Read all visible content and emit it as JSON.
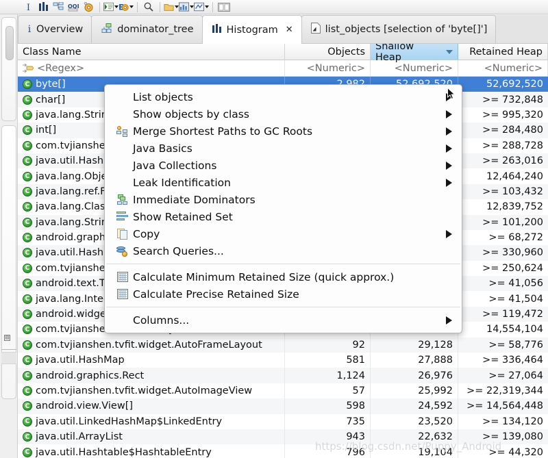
{
  "toolbar": {
    "buttons": [
      {
        "name": "info-icon",
        "glyph": "I",
        "caret": false
      },
      {
        "name": "histogram-icon",
        "glyph": "bars",
        "caret": false
      },
      {
        "name": "dominator-tree-icon",
        "glyph": "tree",
        "caret": false
      },
      {
        "name": "oql-icon",
        "glyph": "OQL",
        "caret": false
      },
      {
        "name": "gear-icon",
        "glyph": "gear",
        "caret": false
      },
      {
        "name": "open-query-browser-icon",
        "glyph": "querylist",
        "caret": true
      },
      {
        "name": "run-expert-system-icon",
        "glyph": "euro-gear",
        "caret": true
      },
      {
        "name": "search-icon",
        "glyph": "magnifier",
        "caret": false
      },
      {
        "name": "group-by-icon",
        "glyph": "folder",
        "caret": true
      },
      {
        "name": "chart-icon",
        "glyph": "chart",
        "caret": true
      },
      {
        "name": "export-icon",
        "glyph": "export",
        "caret": true
      },
      {
        "name": "compare-panes-icon",
        "glyph": "panes",
        "caret": false
      }
    ]
  },
  "tabs": [
    {
      "label": "Overview",
      "icon": "info-icon",
      "active": false,
      "closable": false
    },
    {
      "label": "dominator_tree",
      "icon": "tree-icon",
      "active": false,
      "closable": false
    },
    {
      "label": "Histogram",
      "icon": "histogram-icon",
      "active": true,
      "closable": true
    },
    {
      "label": "list_objects [selection of 'byte[]']",
      "icon": "document-icon",
      "active": false,
      "closable": false
    }
  ],
  "tab_close_glyph": "✕",
  "table": {
    "columns": [
      {
        "label": "Class Name",
        "sorted": false,
        "align": "left"
      },
      {
        "label": "Objects",
        "sorted": false,
        "align": "right"
      },
      {
        "label": "Shallow Heap",
        "sorted": true,
        "sort_dir": "desc",
        "align": "right"
      },
      {
        "label": "Retained Heap",
        "sorted": false,
        "align": "right"
      }
    ],
    "filter_row": {
      "class_name": "<Regex>",
      "objects": "<Numeric>",
      "shallow_heap": "<Numeric>",
      "retained_heap": "<Numeric>"
    },
    "rows": [
      {
        "class_name": "byte[]",
        "objects": "2,982",
        "shallow_heap": "52,692,520",
        "retained_heap": "52,692,520",
        "selected": true
      },
      {
        "class_name": "char[]",
        "objects": "",
        "shallow_heap": "",
        "retained_heap": ">= 732,848",
        "selected": false
      },
      {
        "class_name": "java.lang.String",
        "objects": "",
        "shallow_heap": "",
        "retained_heap": ">= 995,320",
        "selected": false
      },
      {
        "class_name": "int[]",
        "objects": "",
        "shallow_heap": "",
        "retained_heap": ">= 284,480",
        "selected": false
      },
      {
        "class_name": "com.tvjianshen.tvfit",
        "objects": "",
        "shallow_heap": "",
        "retained_heap": ">= 288,728",
        "selected": false
      },
      {
        "class_name": "java.util.HashMap$HashMapEntry",
        "objects": "",
        "shallow_heap": "",
        "retained_heap": ">= 263,016",
        "selected": false
      },
      {
        "class_name": "java.lang.Object[]",
        "objects": "",
        "shallow_heap": "",
        "retained_heap": "12,464,240",
        "selected": false
      },
      {
        "class_name": "java.lang.ref.FinalizerReference",
        "objects": "",
        "shallow_heap": "",
        "retained_heap": ">= 103,432",
        "selected": false
      },
      {
        "class_name": "java.lang.Class",
        "objects": "",
        "shallow_heap": "",
        "retained_heap": "12,839,752",
        "selected": false
      },
      {
        "class_name": "java.lang.String[]",
        "objects": "",
        "shallow_heap": "",
        "retained_heap": ">= 101,200",
        "selected": false
      },
      {
        "class_name": "android.graphics.Bitmap",
        "objects": "",
        "shallow_heap": "",
        "retained_heap": ">= 68,272",
        "selected": false
      },
      {
        "class_name": "java.util.HashMap",
        "objects": "",
        "shallow_heap": "",
        "retained_heap": ">= 330,960",
        "selected": false
      },
      {
        "class_name": "com.tvjianshen.tvfit.widget",
        "objects": "",
        "shallow_heap": "",
        "retained_heap": ">= 250,624",
        "selected": false
      },
      {
        "class_name": "android.text.TextPaint",
        "objects": "",
        "shallow_heap": "",
        "retained_heap": ">= 41,056",
        "selected": false
      },
      {
        "class_name": "java.lang.Integer",
        "objects": "",
        "shallow_heap": "",
        "retained_heap": ">= 41,504",
        "selected": false
      },
      {
        "class_name": "android.widget.TextView",
        "objects": "",
        "shallow_heap": "",
        "retained_heap": ">= 119,472",
        "selected": false
      },
      {
        "class_name": "com.tvjianshen.tvfit.activity",
        "objects": "",
        "shallow_heap": "",
        "retained_heap": "14,554,104",
        "selected": false
      },
      {
        "class_name": "com.tvjianshen.tvfit.widget.AutoFrameLayout",
        "objects": "92",
        "shallow_heap": "29,128",
        "retained_heap": ">= 58,776",
        "selected": false
      },
      {
        "class_name": "java.util.HashMap",
        "objects": "581",
        "shallow_heap": "27,888",
        "retained_heap": ">= 336,464",
        "selected": false
      },
      {
        "class_name": "android.graphics.Rect",
        "objects": "1,124",
        "shallow_heap": "26,976",
        "retained_heap": ">= 27,064",
        "selected": false
      },
      {
        "class_name": "com.tvjianshen.tvfit.widget.AutoImageView",
        "objects": "57",
        "shallow_heap": "25,992",
        "retained_heap": ">= 22,319,344",
        "selected": false
      },
      {
        "class_name": "android.view.View[]",
        "objects": "598",
        "shallow_heap": "24,592",
        "retained_heap": ">= 14,564,448",
        "selected": false
      },
      {
        "class_name": "java.util.LinkedHashMap$LinkedEntry",
        "objects": "735",
        "shallow_heap": "23,520",
        "retained_heap": ">= 134,120",
        "selected": false
      },
      {
        "class_name": "java.util.ArrayList",
        "objects": "943",
        "shallow_heap": "22,632",
        "retained_heap": ">= 139,080",
        "selected": false
      },
      {
        "class_name": "java.util.Hashtable$HashtableEntry",
        "objects": "796",
        "shallow_heap": "19,104",
        "retained_heap": ">= 44,320",
        "selected": false
      }
    ]
  },
  "context_menu": {
    "items": [
      {
        "label": "List objects",
        "icon": null,
        "submenu": true,
        "separator_before": false
      },
      {
        "label": "Show objects by class",
        "icon": null,
        "submenu": true,
        "separator_before": false
      },
      {
        "label": "Merge Shortest Paths to GC Roots",
        "icon": "gc-roots-icon",
        "submenu": true,
        "separator_before": false
      },
      {
        "label": "Java Basics",
        "icon": null,
        "submenu": true,
        "separator_before": false
      },
      {
        "label": "Java Collections",
        "icon": null,
        "submenu": true,
        "separator_before": false
      },
      {
        "label": "Leak Identification",
        "icon": null,
        "submenu": true,
        "separator_before": false
      },
      {
        "label": "Immediate Dominators",
        "icon": "immediate-dominators-icon",
        "submenu": false,
        "separator_before": false
      },
      {
        "label": "Show Retained Set",
        "icon": "retained-set-icon",
        "submenu": false,
        "separator_before": false
      },
      {
        "label": "Copy",
        "icon": "copy-icon",
        "submenu": true,
        "separator_before": false
      },
      {
        "label": "Search Queries...",
        "icon": "search-queries-icon",
        "submenu": false,
        "separator_before": false
      },
      {
        "label": "Calculate Minimum Retained Size (quick approx.)",
        "icon": "calculator-icon",
        "submenu": false,
        "separator_before": true
      },
      {
        "label": "Calculate Precise Retained Size",
        "icon": "calculator-icon",
        "submenu": false,
        "separator_before": false
      },
      {
        "label": "Columns...",
        "icon": null,
        "submenu": true,
        "separator_before": true
      }
    ]
  },
  "watermark": "https://blog.csdn.net/Puppy_Android"
}
